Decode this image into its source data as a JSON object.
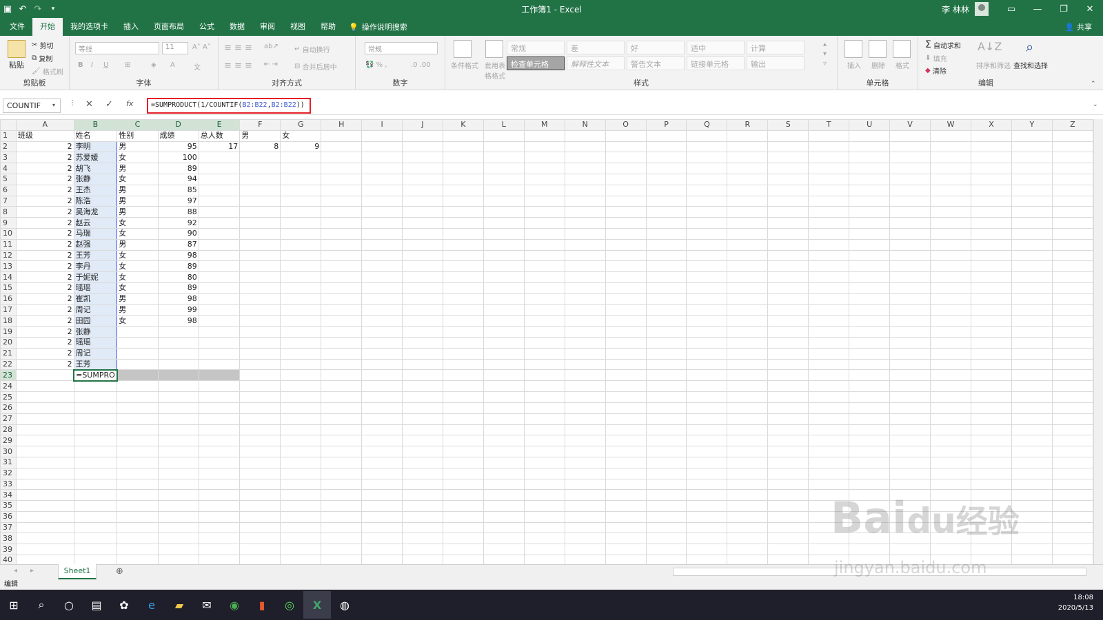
{
  "window": {
    "title": "工作簿1  -  Excel",
    "user": "李 林林"
  },
  "tabs": [
    "文件",
    "开始",
    "我的选项卡",
    "插入",
    "页面布局",
    "公式",
    "数据",
    "审阅",
    "视图",
    "帮助"
  ],
  "tell_me": "操作说明搜索",
  "share": "共享",
  "ribbon": {
    "clipboard": {
      "label": "剪贴板",
      "paste": "粘贴",
      "cut": "剪切",
      "copy": "复制",
      "painter": "格式刷"
    },
    "font": {
      "label": "字体",
      "name": "等线",
      "size": "11"
    },
    "alignment": {
      "label": "对齐方式",
      "wrap": "自动换行",
      "merge": "合并后居中"
    },
    "number": {
      "label": "数字",
      "format": "常规"
    },
    "styles": {
      "label": "样式",
      "conditional": "条件格式",
      "table": "套用表格格式",
      "cells": [
        "常规",
        "差",
        "好",
        "适中",
        "计算",
        "检查单元格",
        "解释性文本",
        "警告文本",
        "链接单元格",
        "输出"
      ]
    },
    "cells": {
      "label": "单元格",
      "insert": "插入",
      "delete": "删除",
      "format": "格式"
    },
    "editing": {
      "label": "编辑",
      "autosum": "自动求和",
      "fill": "填充",
      "clear": "清除",
      "sort": "排序和筛选",
      "find": "查找和选择"
    }
  },
  "formula_bar": {
    "name_box": "COUNTIF",
    "formula_pre": "=SUMPRODUCT(1/COUNTIF(",
    "formula_ref1": "B2:B22",
    "formula_mid": ",",
    "formula_ref2": "B2:B22",
    "formula_post": "))"
  },
  "columns": [
    "A",
    "B",
    "C",
    "D",
    "E",
    "F",
    "G",
    "H",
    "I",
    "J",
    "K",
    "L",
    "M",
    "N",
    "O",
    "P",
    "Q",
    "R",
    "S",
    "T",
    "U",
    "V",
    "W",
    "X",
    "Y",
    "Z"
  ],
  "cells": {
    "1": [
      "班级",
      "姓名",
      "性别",
      "成绩",
      "总人数",
      "男",
      "女"
    ],
    "2": [
      "2",
      "李明",
      "男",
      "95",
      "17",
      "8",
      "9"
    ],
    "3": [
      "2",
      "苏爱媛",
      "女",
      "100"
    ],
    "4": [
      "2",
      "胡飞",
      "男",
      "89"
    ],
    "5": [
      "2",
      "张静",
      "女",
      "94"
    ],
    "6": [
      "2",
      "王杰",
      "男",
      "85"
    ],
    "7": [
      "2",
      "陈浩",
      "男",
      "97"
    ],
    "8": [
      "2",
      "吴海龙",
      "男",
      "88"
    ],
    "9": [
      "2",
      "赵云",
      "女",
      "92"
    ],
    "10": [
      "2",
      "马瑞",
      "女",
      "90"
    ],
    "11": [
      "2",
      "赵强",
      "男",
      "87"
    ],
    "12": [
      "2",
      "王芳",
      "女",
      "98"
    ],
    "13": [
      "2",
      "李丹",
      "女",
      "89"
    ],
    "14": [
      "2",
      "于妮妮",
      "女",
      "80"
    ],
    "15": [
      "2",
      "瑶瑶",
      "女",
      "89"
    ],
    "16": [
      "2",
      "崔凯",
      "男",
      "98"
    ],
    "17": [
      "2",
      "周记",
      "男",
      "99"
    ],
    "18": [
      "2",
      "田园",
      "女",
      "98"
    ],
    "19": [
      "2",
      "张静"
    ],
    "20": [
      "2",
      "瑶瑶"
    ],
    "21": [
      "2",
      "周记"
    ],
    "22": [
      "2",
      "王芳"
    ],
    "23": [
      "",
      "=SUMPRO"
    ]
  },
  "row_count": 40,
  "sheet_tab": "Sheet1",
  "status": "编辑",
  "clock": {
    "time": "18:08",
    "date": "2020/5/13"
  },
  "watermark": {
    "line1": "Bai",
    "line2": "du",
    "line3": "经验",
    "url": "jingyan.baidu.com"
  },
  "colors": {
    "excel_green": "#217346",
    "formula_highlight": "#e41e26",
    "range_blue": "#3a59d4"
  }
}
